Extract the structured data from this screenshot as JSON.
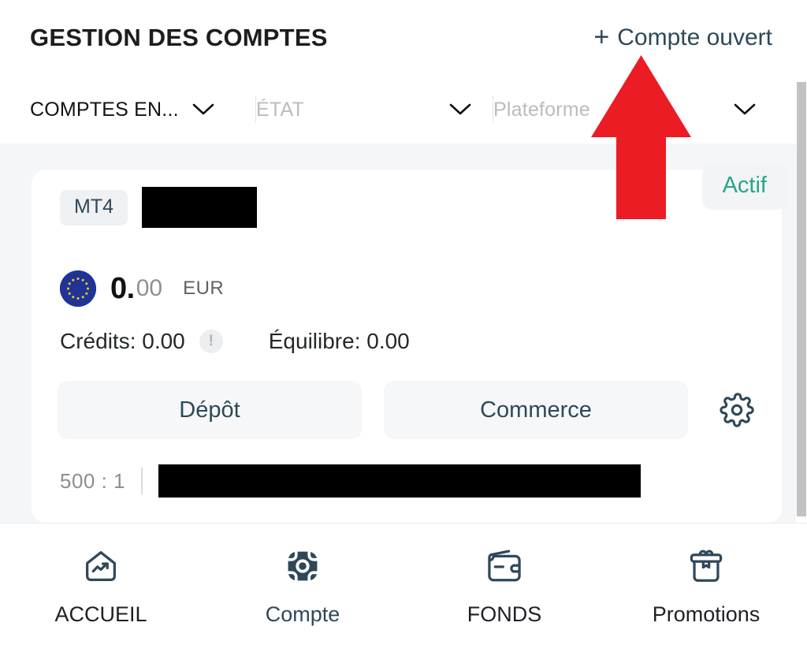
{
  "header": {
    "title": "GESTION DES COMPTES",
    "open_account_label": "Compte ouvert",
    "open_account_icon": "plus-icon",
    "plus_glyph": "+",
    "accent_color": "#2f4858"
  },
  "filters": [
    {
      "label": "COMPTES EN...",
      "state": "active",
      "icon": "chevron-down-icon"
    },
    {
      "label": "ÉTAT",
      "state": "muted",
      "icon": "chevron-down-icon"
    },
    {
      "label": "Plateforme",
      "state": "muted",
      "icon": "chevron-down-icon"
    }
  ],
  "account_card": {
    "platform_badge": "MT4",
    "account_name_redacted": true,
    "status_label": "Actif",
    "status_color": "#28a68b",
    "currency_flag": "eu-flag-icon",
    "balance_integer": "0.",
    "balance_decimals": "00",
    "currency_code": "EUR",
    "credits_label": "Crédits: 0.00",
    "credits_info_icon": "info-icon",
    "info_glyph": "!",
    "equilibre_label": "Équilibre:  0.00",
    "deposit_label": "Dépôt",
    "trade_label": "Commerce",
    "settings_icon": "gear-icon",
    "leverage": "500 : 1",
    "server_redacted": true
  },
  "bottom_nav": {
    "items": [
      {
        "label": "ACCUEIL",
        "icon": "home-chart-icon",
        "active": false
      },
      {
        "label": "Compte",
        "icon": "account-filled-icon",
        "active": true
      },
      {
        "label": "FONDS",
        "icon": "wallet-icon",
        "active": false
      },
      {
        "label": "Promotions",
        "icon": "gift-icon",
        "active": false
      }
    ]
  },
  "annotation": {
    "arrow_icon": "red-up-arrow-annotation",
    "arrow_color": "#ec1c24",
    "points_at": "Compte ouvert"
  },
  "scrollbar": {
    "icon": "vertical-scrollbar",
    "thumb_color": "#c2c2c2"
  }
}
